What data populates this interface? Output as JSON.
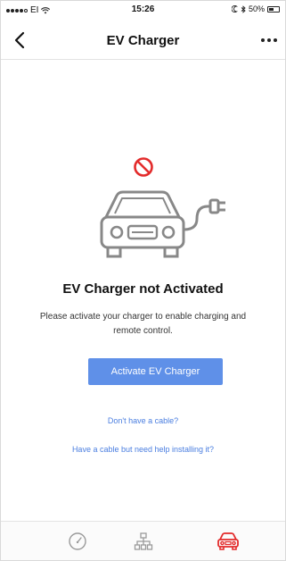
{
  "status_bar": {
    "carrier": "EI",
    "time": "15:26",
    "battery_text": "50%",
    "battery_level": 0.5
  },
  "nav": {
    "title": "EV Charger"
  },
  "main": {
    "heading": "EV Charger not Activated",
    "description": "Please activate your charger to enable charging and remote control.",
    "activate_label": "Activate EV Charger",
    "link_cable": "Don't have a cable?",
    "link_install": "Have a cable but need help installing it?"
  },
  "colors": {
    "accent": "#5f90e8",
    "link": "#4a7ee0",
    "blocked": "#e32b2b",
    "active_tab": "#e32b2b",
    "inactive_icon": "#9a9a9a"
  },
  "tabs": [
    {
      "icon": "speedometer-icon",
      "active": false
    },
    {
      "icon": "network-icon",
      "active": false
    },
    {
      "icon": "car-icon",
      "active": true
    }
  ]
}
